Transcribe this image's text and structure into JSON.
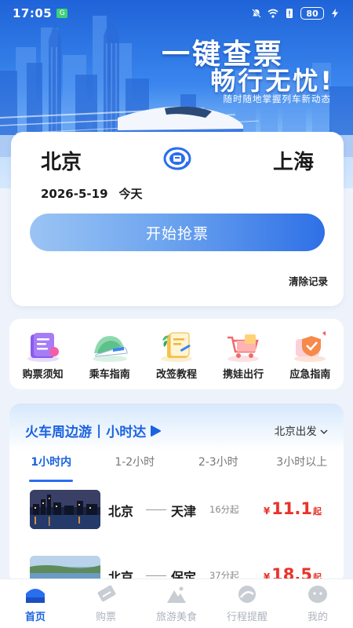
{
  "status_bar": {
    "time": "17:05",
    "battery": "80",
    "app_badge": "G"
  },
  "hero": {
    "title_line1": "一键查票",
    "title_line2": "畅行无忧!",
    "subtitle": "随时随地掌握列车新动态"
  },
  "ticket": {
    "from_city": "北京",
    "to_city": "上海",
    "date": "2026-5-19",
    "day_label": "今天",
    "grab_button": "开始抢票",
    "clear_records": "清除记录"
  },
  "quick_entries": [
    {
      "label": "购票须知",
      "icon": "ticket-notice-icon"
    },
    {
      "label": "乘车指南",
      "icon": "train-guide-icon"
    },
    {
      "label": "改签教程",
      "icon": "reschedule-tutorial-icon"
    },
    {
      "label": "携娃出行",
      "icon": "travel-with-kids-icon"
    },
    {
      "label": "应急指南",
      "icon": "emergency-guide-icon"
    }
  ],
  "trips": {
    "heading_left": "火车周边游",
    "heading_sep": "|",
    "heading_right": "小时达",
    "origin": "北京出发",
    "tabs": [
      "1小时内",
      "1-2小时",
      "2-3小时",
      "3小时以上"
    ],
    "active_tab": 0,
    "routes": [
      {
        "from": "北京",
        "to": "天津",
        "duration": "16分起",
        "currency": "¥",
        "price": "11.1",
        "price_suffix": "起"
      },
      {
        "from": "北京",
        "to": "保定",
        "duration": "37分起",
        "currency": "¥",
        "price": "18.5",
        "price_suffix": "起"
      }
    ]
  },
  "bottom_nav": [
    {
      "label": "首页",
      "icon": "home-icon",
      "active": true
    },
    {
      "label": "购票",
      "icon": "ticket-icon",
      "active": false
    },
    {
      "label": "旅游美食",
      "icon": "mountain-icon",
      "active": false
    },
    {
      "label": "行程提醒",
      "icon": "reminder-icon",
      "active": false
    },
    {
      "label": "我的",
      "icon": "profile-icon",
      "active": false
    }
  ],
  "colors": {
    "accent": "#1b63e0",
    "price": "#e8332a",
    "hero_top": "#1f63d8"
  }
}
